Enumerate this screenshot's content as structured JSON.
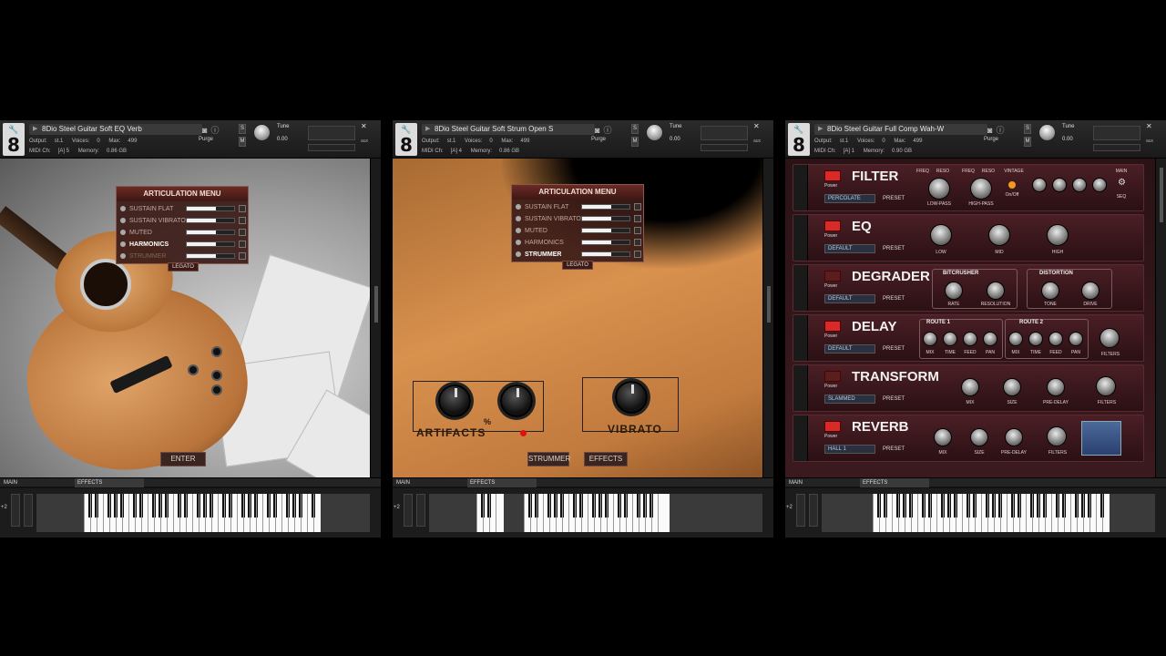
{
  "panels": [
    {
      "title": "8Dio Steel Guitar Soft EQ Verb",
      "output_label": "Output:",
      "output_val": "st.1",
      "voices_label": "Voices:",
      "voices_val": "0",
      "max_label": "Max:",
      "max_val": "499",
      "purge": "Purge",
      "midi_label": "MIDI Ch:",
      "midi_val": "[A] 5",
      "memory_label": "Memory:",
      "memory_val": "0.86 GB",
      "tune_label": "Tune",
      "tune_val": "0.00",
      "tab_main": "MAIN",
      "tab_effects": "EFFECTS"
    },
    {
      "title": "8Dio Steel Guitar Soft Strum Open S",
      "output_label": "Output:",
      "output_val": "st.1",
      "voices_label": "Voices:",
      "voices_val": "0",
      "max_label": "Max:",
      "max_val": "499",
      "purge": "Purge",
      "midi_label": "MIDI Ch:",
      "midi_val": "[A] 4",
      "memory_label": "Memory:",
      "memory_val": "0.86 GB",
      "tune_label": "Tune",
      "tune_val": "0.00",
      "tab_main": "MAIN",
      "tab_effects": "EFFECTS"
    },
    {
      "title": "8Dio Steel Guitar Full Comp Wah-W",
      "output_label": "Output:",
      "output_val": "st.1",
      "voices_label": "Voices:",
      "voices_val": "0",
      "max_label": "Max:",
      "max_val": "499",
      "purge": "Purge",
      "midi_label": "MIDI Ch:",
      "midi_val": "[A] 1",
      "memory_label": "Memory:",
      "memory_val": "0.90 GB",
      "tune_label": "Tune",
      "tune_val": "0.00",
      "tab_main": "MAIN",
      "tab_effects": "EFFECTS"
    }
  ],
  "articulation_menu": {
    "title": "ARTICULATION MENU",
    "items": [
      {
        "label": "SUSTAIN FLAT",
        "level": 0.62
      },
      {
        "label": "SUSTAIN VIBRATO",
        "level": 0.62
      },
      {
        "label": "MUTED",
        "level": 0.62
      },
      {
        "label": "HARMONICS",
        "level": 0.62
      },
      {
        "label": "STRUMMER",
        "level": 0.62
      }
    ],
    "legato": "LEGATO"
  },
  "panel1": {
    "active_item": "HARMONICS",
    "enter": "ENTER"
  },
  "panel2": {
    "active_item": "STRUMMER",
    "artifacts": "ARTIFACTS",
    "percent": "%",
    "vibrato": "VIBRATO",
    "strummer_btn": "STRUMMER",
    "effects_btn": "EFFECTS"
  },
  "fx": {
    "power": "Power",
    "preset_lbl": "PRESET",
    "filter": {
      "name": "FILTER",
      "preset": "PERCOLATE",
      "freq": "FREQ",
      "reso": "RESO",
      "low_pass": "LOW-PASS",
      "high_pass": "HIGH-PASS",
      "vintage": "VINTAGE",
      "onoff": "On/Off",
      "main": "MAIN",
      "seq": "SEQ"
    },
    "eq": {
      "name": "EQ",
      "preset": "DEFAULT",
      "low": "LOW",
      "mid": "MID",
      "high": "HIGH"
    },
    "degrader": {
      "name": "DEGRADER",
      "preset": "DEFAULT",
      "bitcrusher": "BITCRUSHER",
      "distortion": "DISTORTION",
      "rate": "RATE",
      "resolution": "RESOLUTION",
      "tone": "TONE",
      "drive": "DRIVE"
    },
    "delay": {
      "name": "DELAY",
      "preset": "DEFAULT",
      "route1": "ROUTE 1",
      "route2": "ROUTE 2",
      "mix": "MIX",
      "time": "TIME",
      "feed": "FEED",
      "pan": "PAN",
      "filters": "FILTERS"
    },
    "transform": {
      "name": "TRANSFORM",
      "preset": "SLAMMED",
      "mix": "MIX",
      "size": "SIZE",
      "predelay": "PRE-DELAY",
      "filters": "FILTERS"
    },
    "reverb": {
      "name": "REVERB",
      "preset": "HALL 1",
      "mix": "MIX",
      "size": "SIZE",
      "predelay": "PRE-DELAY",
      "filters": "FILTERS"
    }
  },
  "colors": {
    "accent_red": "#d92a2a",
    "menu_bg": "#3c1c18"
  }
}
